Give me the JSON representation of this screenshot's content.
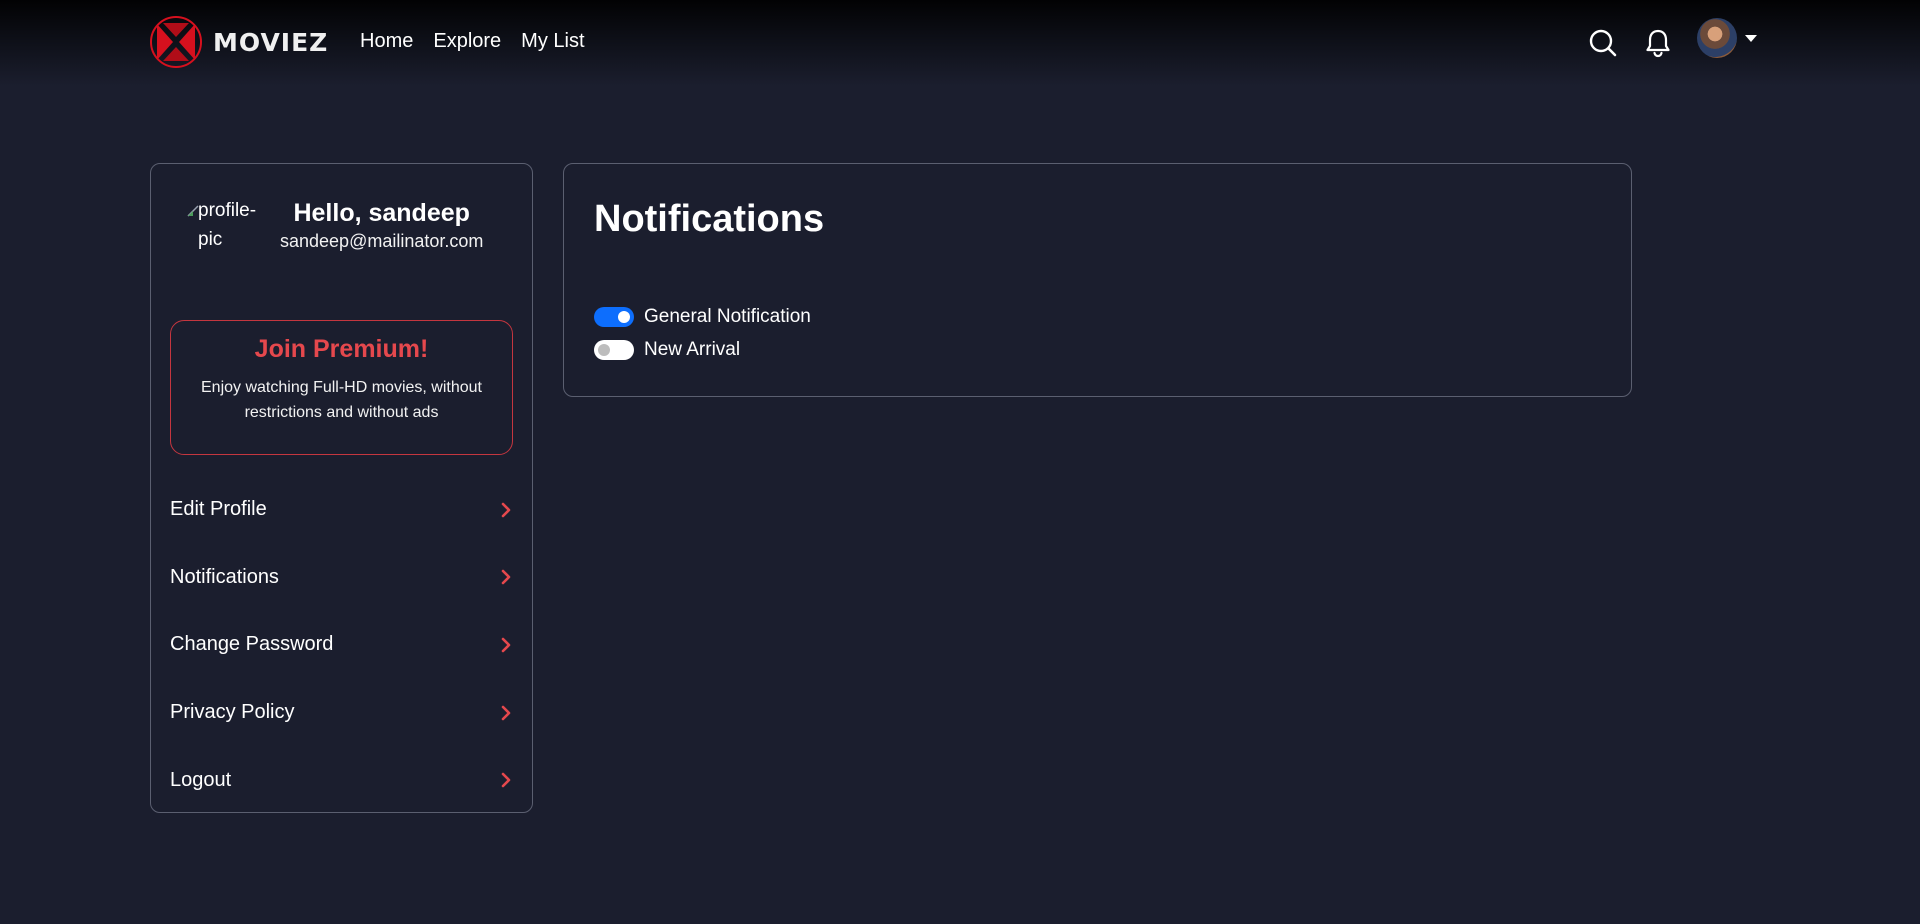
{
  "header": {
    "brand": "MOVIEZ",
    "nav": [
      {
        "label": "Home"
      },
      {
        "label": "Explore"
      },
      {
        "label": "My List"
      }
    ],
    "icons": [
      "search-icon",
      "bell-icon",
      "avatar",
      "caret-down-icon"
    ]
  },
  "sidebar": {
    "profile_pic_alt": "profile-pic",
    "greeting": "Hello, sandeep",
    "email": "sandeep@mailinator.com",
    "premium": {
      "title": "Join Premium!",
      "description": "Enjoy watching Full-HD movies, without restrictions and without ads"
    },
    "menu": [
      {
        "label": "Edit Profile"
      },
      {
        "label": "Notifications"
      },
      {
        "label": "Change Password"
      },
      {
        "label": "Privacy Policy"
      },
      {
        "label": "Logout"
      }
    ]
  },
  "main": {
    "title": "Notifications",
    "toggles": [
      {
        "label": "General Notification",
        "checked": true
      },
      {
        "label": "New Arrival",
        "checked": false
      }
    ]
  },
  "colors": {
    "background": "#1b1e2e",
    "accent_red": "#e5484d",
    "toggle_blue": "#0d6efd",
    "border": "#5b5f70"
  }
}
